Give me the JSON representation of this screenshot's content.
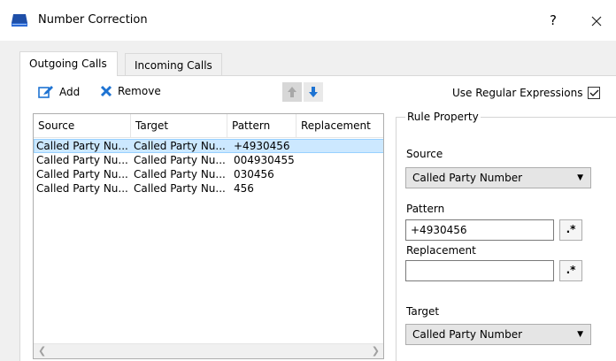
{
  "window": {
    "title": "Number Correction",
    "help_glyph": "?",
    "close_glyph": "✕"
  },
  "tabs": [
    {
      "label": "Outgoing Calls",
      "active": true
    },
    {
      "label": "Incoming Calls",
      "active": false
    }
  ],
  "toolbar": {
    "add_label": "Add",
    "remove_label": "Remove"
  },
  "regex": {
    "label": "Use Regular Expressions",
    "checked": true
  },
  "table": {
    "columns": [
      "Source",
      "Target",
      "Pattern",
      "Replacement"
    ],
    "rows": [
      {
        "source": "Called Party Nu...",
        "target": "Called Party Nu...",
        "pattern": "+4930456",
        "replacement": "",
        "selected": true
      },
      {
        "source": "Called Party Nu...",
        "target": "Called Party Nu...",
        "pattern": "004930455",
        "replacement": ""
      },
      {
        "source": "Called Party Nu...",
        "target": "Called Party Nu...",
        "pattern": "030456",
        "replacement": ""
      },
      {
        "source": "Called Party Nu...",
        "target": "Called Party Nu...",
        "pattern": "456",
        "replacement": ""
      }
    ]
  },
  "rule_property": {
    "title": "Rule Property",
    "source_label": "Source",
    "source_value": "Called Party Number",
    "pattern_label": "Pattern",
    "pattern_value": "+4930456",
    "replacement_label": "Replacement",
    "replacement_value": "",
    "target_label": "Target",
    "target_value": "Called Party Number",
    "regex_button_glyph": ".*"
  },
  "colors": {
    "accent": "#1e73d2",
    "selection": "#cce8ff",
    "remove_icon": "#1e73d2"
  }
}
